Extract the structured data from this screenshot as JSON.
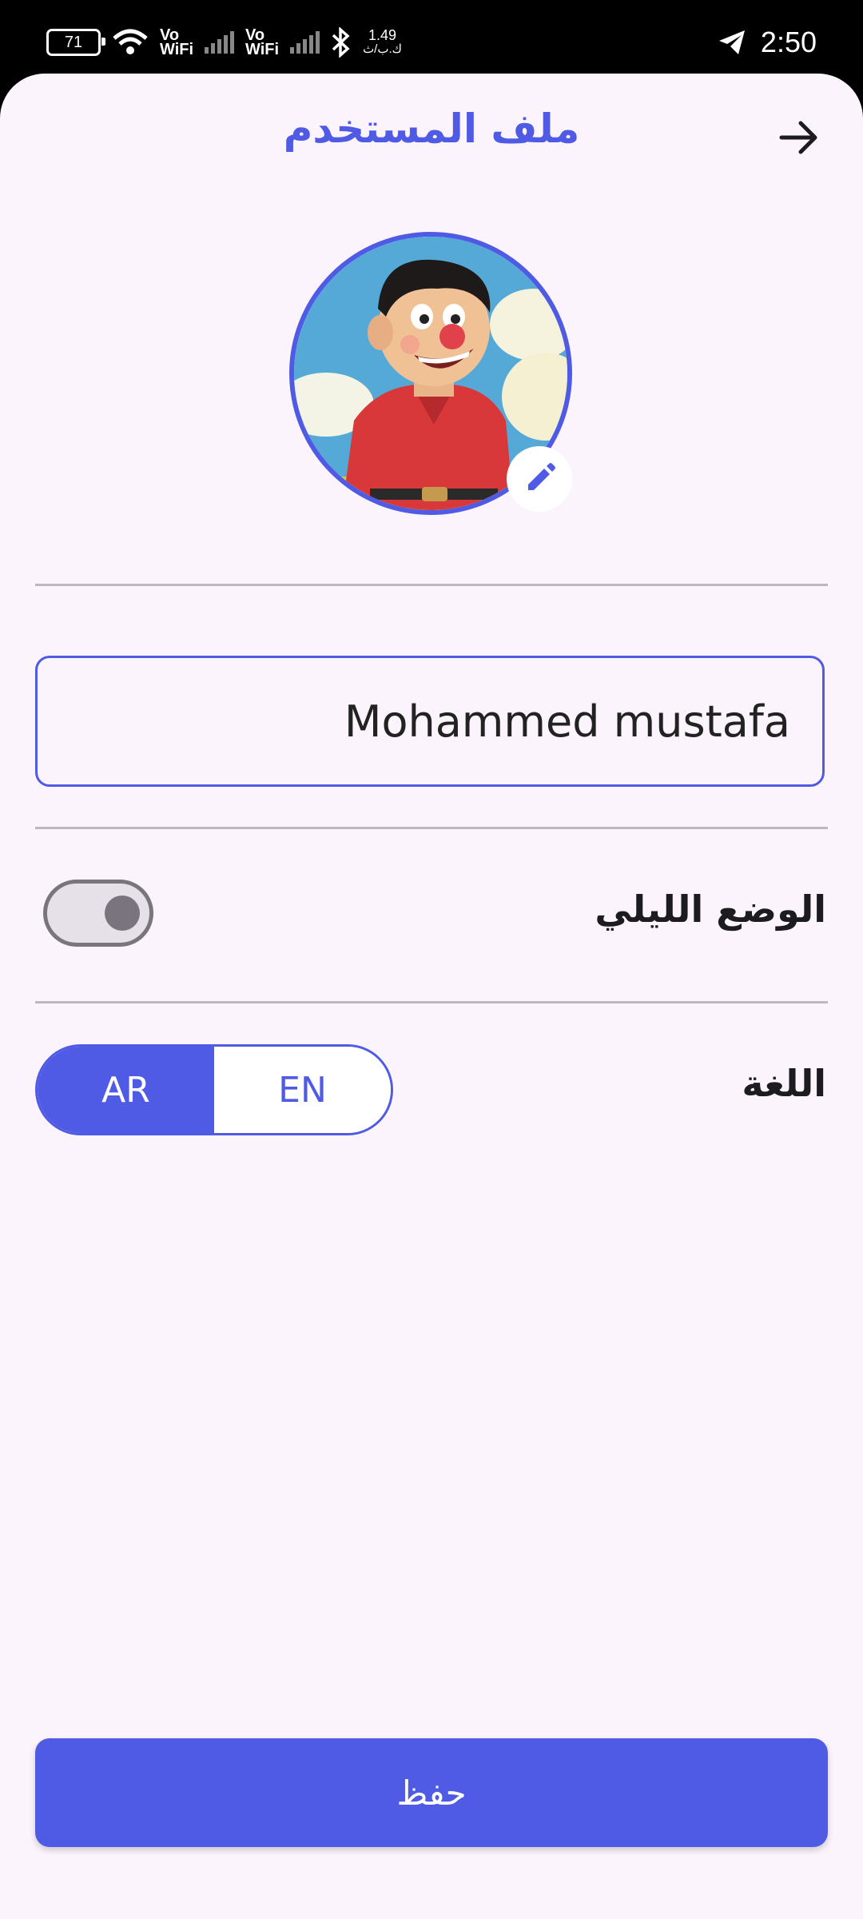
{
  "status_bar": {
    "battery": "71",
    "vo_wifi_1": "Vo\nWiFi",
    "vo_wifi_2": "Vo\nWiFi",
    "net_speed": "1.49",
    "net_unit": "ك.ب/ث",
    "time": "2:50"
  },
  "header": {
    "title": "ملف المستخدم"
  },
  "profile": {
    "name_value": "Mohammed mustafa"
  },
  "settings": {
    "dark_mode_label": "الوضع الليلي",
    "dark_mode_on": false,
    "language_label": "اللغة",
    "language_options": [
      "AR",
      "EN"
    ],
    "language_selected": "AR"
  },
  "actions": {
    "save_label": "حفظ"
  },
  "colors": {
    "accent": "#4f5ae5",
    "background": "#fcf4fc"
  }
}
